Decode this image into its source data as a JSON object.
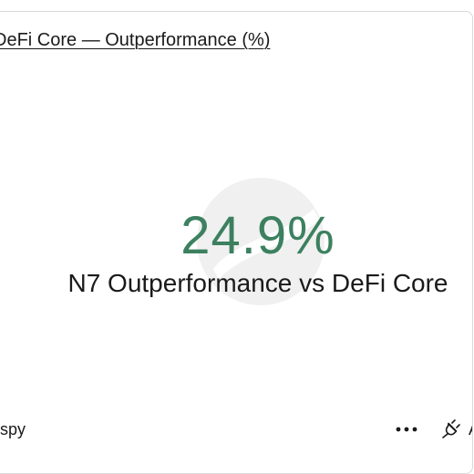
{
  "card": {
    "title": "DeFi Core — Outperformance (%)",
    "metric_value": "24.9%",
    "metric_label": "N7 Outperformance vs DeFi Core",
    "metric_color": "#3c8060"
  },
  "footer": {
    "source_label": "spy",
    "more_icon": "more-horizontal-icon",
    "plug_icon": "plug-icon",
    "clipped_text": "A"
  }
}
